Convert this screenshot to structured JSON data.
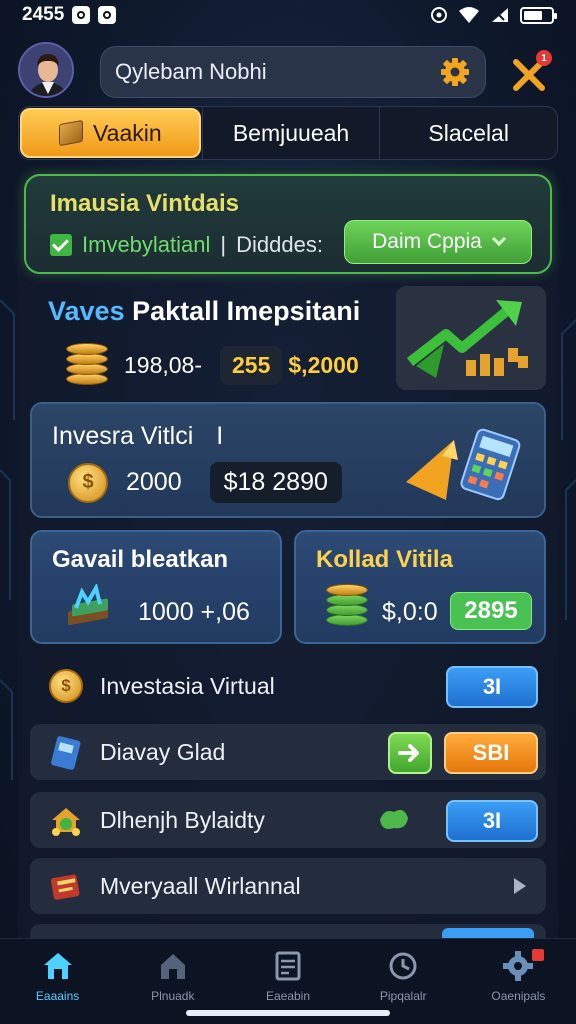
{
  "status_bar": {
    "time": "2455"
  },
  "header": {
    "search_text": "Qylebam Nobhi",
    "notification_count": "1"
  },
  "tabs": [
    {
      "label": "Vaakin"
    },
    {
      "label": "Bemjuueah"
    },
    {
      "label": "Slacelal"
    }
  ],
  "alert": {
    "title": "Imausia Vintdais",
    "check_label": "Imvebylatianl",
    "separator": "|",
    "sub_label": "Didddes:",
    "button_label": "Daim Cppia"
  },
  "value_card": {
    "title_blue": "Vaves",
    "title_rest": "Paktall Imepsitani",
    "value_a": "198,08-",
    "value_b": "255",
    "value_c": "$,2000"
  },
  "invest_card": {
    "title": "Invesra Vitlci",
    "title_suffix": "I",
    "value_a": "2000",
    "value_b": "$18 2890"
  },
  "mini_cards": [
    {
      "title": "Gavail bleatkan",
      "value": "1000 +,06"
    },
    {
      "title": "Kollad Vitila",
      "value": "$,0:0",
      "badge": "2895"
    }
  ],
  "list": [
    {
      "label": "Investasia Virtual",
      "button": "3I"
    },
    {
      "label": "Diavay Glad",
      "button": "SBI"
    },
    {
      "label": "Dlhenjh Bylaidty",
      "button": "3I"
    },
    {
      "label": "Mveryaall Wirlannal"
    }
  ],
  "bottom_nav": [
    {
      "label": "Eaaains",
      "icon": "home-icon"
    },
    {
      "label": "Plnuadk",
      "icon": "house-icon"
    },
    {
      "label": "Eaeabin",
      "icon": "document-icon"
    },
    {
      "label": "Pipqalalr",
      "icon": "clock-icon"
    },
    {
      "label": "Oaenipals",
      "icon": "gear-icon"
    }
  ],
  "colors": {
    "accent_gold": "#f5a623",
    "accent_green": "#49c253",
    "accent_blue": "#3b9ef5",
    "background": "#0f1a2e"
  }
}
